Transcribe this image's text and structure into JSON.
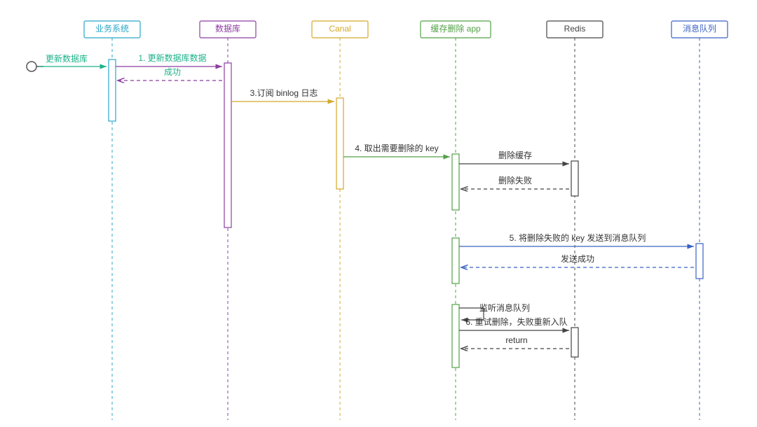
{
  "participants": {
    "biz": {
      "label": "业务系统",
      "color": "#2aa6c8"
    },
    "db": {
      "label": "数据库",
      "color": "#8e3ea1"
    },
    "canal": {
      "label": "Canal",
      "color": "#d4a82a"
    },
    "app": {
      "label": "缓存删除 app",
      "color": "#52a146"
    },
    "redis": {
      "label": "Redis",
      "color": "#444444"
    },
    "mq": {
      "label": "消息队列",
      "color": "#3a62c4"
    }
  },
  "actor": {
    "label": "更新数据库",
    "color": "#1db28a"
  },
  "messages": {
    "m1": "1. 更新数据库数据",
    "m2": "成功",
    "m3": "3.订阅 binlog 日志",
    "m4": "4. 取出需要删除的 key",
    "m5": "删除缓存",
    "m6": "删除失败",
    "m7": "5. 将删除失败的 key 发送到消息队列",
    "m8": "发送成功",
    "m9": "监听消息队列",
    "m10": "6. 重试删除，失败重新入队",
    "m11": "return"
  }
}
